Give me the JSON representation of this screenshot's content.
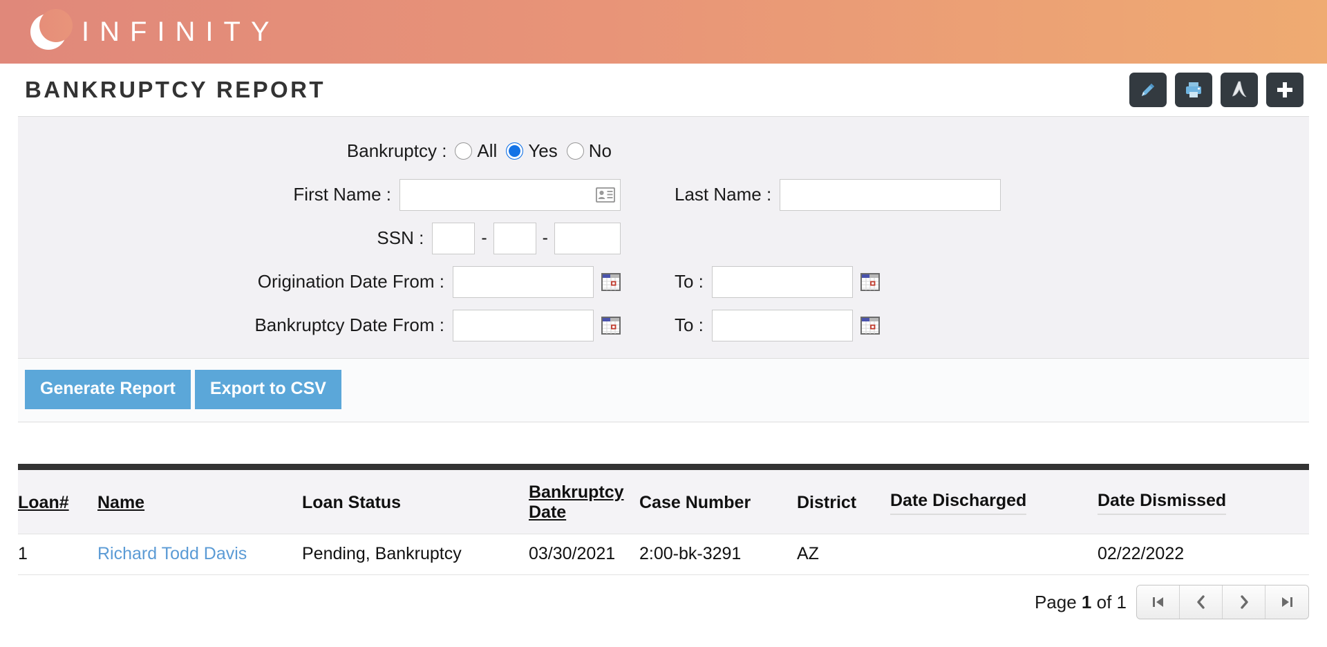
{
  "brand": {
    "name": "INFINITY",
    "logo_icon": "crescent-logo-icon",
    "gradient_from": "#e0887a",
    "gradient_to": "#efab72"
  },
  "header": {
    "title": "BANKRUPTCY REPORT",
    "tools": [
      {
        "name": "edit-button",
        "icon": "pencil-icon"
      },
      {
        "name": "print-button",
        "icon": "printer-icon"
      },
      {
        "name": "pdf-button",
        "icon": "pdf-icon"
      },
      {
        "name": "add-button",
        "icon": "plus-icon"
      }
    ]
  },
  "filters": {
    "bankruptcy": {
      "label": "Bankruptcy :",
      "options": [
        "All",
        "Yes",
        "No"
      ],
      "selected": "Yes"
    },
    "first_name": {
      "label": "First Name :",
      "value": "",
      "placeholder": "",
      "icon": "contact-card-icon"
    },
    "last_name": {
      "label": "Last Name :",
      "value": "",
      "placeholder": ""
    },
    "ssn": {
      "label": "SSN :",
      "part1": "",
      "part2": "",
      "part3": "",
      "separator": "-"
    },
    "origination_date": {
      "from_label": "Origination Date From :",
      "from_value": "",
      "to_label": "To :",
      "to_value": "",
      "icon": "calendar-icon"
    },
    "bankruptcy_date": {
      "from_label": "Bankruptcy Date From :",
      "from_value": "",
      "to_label": "To :",
      "to_value": "",
      "icon": "calendar-icon"
    }
  },
  "actions": {
    "generate_label": "Generate Report",
    "export_label": "Export to CSV",
    "button_color": "#5ba7d9"
  },
  "results": {
    "columns": [
      {
        "label": "Loan#",
        "sortable": true
      },
      {
        "label": "Name",
        "sortable": true
      },
      {
        "label": "Loan Status",
        "sortable": false
      },
      {
        "label": "Bankruptcy Date",
        "sortable": true
      },
      {
        "label": "Case Number",
        "sortable": false
      },
      {
        "label": "District",
        "sortable": false
      },
      {
        "label": "Date Discharged",
        "sortable": false
      },
      {
        "label": "Date Dismissed",
        "sortable": false
      }
    ],
    "rows": [
      {
        "loan": "1",
        "name": "Richard Todd Davis",
        "status": "Pending, Bankruptcy",
        "bankruptcy_date": "03/30/2021",
        "case_number": "2:00-bk-3291",
        "district": "AZ",
        "date_discharged": "",
        "date_dismissed": "02/22/2022"
      }
    ],
    "link_color": "#5b9bd5"
  },
  "pagination": {
    "prefix": "Page",
    "current": "1",
    "middle": "of",
    "total": "1",
    "buttons": [
      {
        "name": "first-page-button",
        "glyph": "|◀"
      },
      {
        "name": "prev-page-button",
        "glyph": "‹"
      },
      {
        "name": "next-page-button",
        "glyph": "›"
      },
      {
        "name": "last-page-button",
        "glyph": "▶|"
      }
    ]
  }
}
